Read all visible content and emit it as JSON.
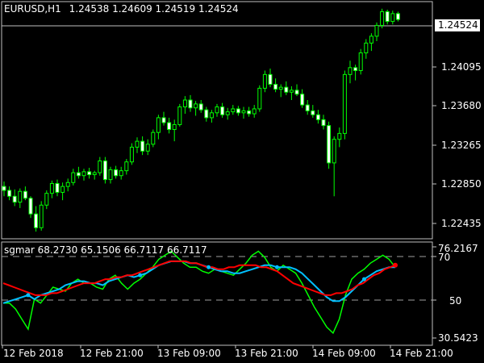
{
  "header": {
    "symbol": "EURUSD,H1",
    "ohlc": "1.24538 1.24609 1.24519 1.24524"
  },
  "indicator": {
    "label": "sgmar 68.2730 65.1506 66.7117 66.7117",
    "scale_max": "76.2167",
    "scale_min": "30.5423",
    "level_high": "70",
    "level_low": "50"
  },
  "current_price": "1.24524",
  "price_axis": [
    "1.24095",
    "1.23680",
    "1.23265",
    "1.22850",
    "1.22435"
  ],
  "time_axis": [
    "12 Feb 2018",
    "12 Feb 21:00",
    "13 Feb 09:00",
    "13 Feb 21:00",
    "14 Feb 09:00",
    "14 Feb 21:00"
  ],
  "colors": {
    "background": "#000000",
    "bull_candle": "#00ff00",
    "bear_candle": "#ffffff",
    "osc_green": "#00ff00",
    "osc_cyan": "#00c0ff",
    "osc_red": "#ff0000"
  },
  "chart_data": {
    "type": "candlestick",
    "price_range": [
      1.2232,
      1.2462
    ],
    "candles": [
      [
        1.2282,
        1.2287,
        1.2272,
        1.2278
      ],
      [
        1.2278,
        1.2282,
        1.2268,
        1.2272
      ],
      [
        1.2272,
        1.2279,
        1.2262,
        1.2266
      ],
      [
        1.2266,
        1.228,
        1.226,
        1.2277
      ],
      [
        1.2277,
        1.2282,
        1.2268,
        1.227
      ],
      [
        1.227,
        1.2272,
        1.225,
        1.2254
      ],
      [
        1.2254,
        1.2262,
        1.2236,
        1.224
      ],
      [
        1.224,
        1.2267,
        1.2237,
        1.2263
      ],
      [
        1.2263,
        1.2278,
        1.2259,
        1.2275
      ],
      [
        1.2275,
        1.2288,
        1.227,
        1.2285
      ],
      [
        1.2285,
        1.2289,
        1.2272,
        1.2276
      ],
      [
        1.2276,
        1.2286,
        1.2268,
        1.2282
      ],
      [
        1.2282,
        1.229,
        1.2277,
        1.2286
      ],
      [
        1.2286,
        1.23,
        1.2283,
        1.2296
      ],
      [
        1.2296,
        1.2302,
        1.229,
        1.2293
      ],
      [
        1.2293,
        1.23,
        1.2288,
        1.2297
      ],
      [
        1.2297,
        1.2301,
        1.229,
        1.2294
      ],
      [
        1.2294,
        1.2298,
        1.2289,
        1.2296
      ],
      [
        1.2296,
        1.2312,
        1.2293,
        1.2308
      ],
      [
        1.2308,
        1.2312,
        1.2285,
        1.2289
      ],
      [
        1.2289,
        1.2302,
        1.2285,
        1.2299
      ],
      [
        1.2299,
        1.2303,
        1.229,
        1.2293
      ],
      [
        1.2293,
        1.2302,
        1.2289,
        1.2298
      ],
      [
        1.2298,
        1.231,
        1.2294,
        1.2307
      ],
      [
        1.2307,
        1.2326,
        1.2304,
        1.2322
      ],
      [
        1.2322,
        1.2332,
        1.2316,
        1.2328
      ],
      [
        1.2328,
        1.2333,
        1.2314,
        1.2318
      ],
      [
        1.2318,
        1.233,
        1.2314,
        1.2325
      ],
      [
        1.2325,
        1.234,
        1.2322,
        1.2337
      ],
      [
        1.2337,
        1.2355,
        1.233,
        1.2352
      ],
      [
        1.2352,
        1.2358,
        1.2344,
        1.2347
      ],
      [
        1.2347,
        1.2352,
        1.2336,
        1.234
      ],
      [
        1.234,
        1.235,
        1.2328,
        1.2345
      ],
      [
        1.2345,
        1.2366,
        1.2343,
        1.2363
      ],
      [
        1.2363,
        1.2374,
        1.2356,
        1.237
      ],
      [
        1.237,
        1.2375,
        1.2358,
        1.2362
      ],
      [
        1.2362,
        1.2369,
        1.2354,
        1.2366
      ],
      [
        1.2366,
        1.237,
        1.2357,
        1.236
      ],
      [
        1.236,
        1.2363,
        1.2348,
        1.2352
      ],
      [
        1.2352,
        1.236,
        1.2347,
        1.2357
      ],
      [
        1.2357,
        1.2366,
        1.2353,
        1.2363
      ],
      [
        1.2363,
        1.2367,
        1.2352,
        1.2355
      ],
      [
        1.2355,
        1.2362,
        1.235,
        1.2358
      ],
      [
        1.2358,
        1.2365,
        1.2355,
        1.2361
      ],
      [
        1.2361,
        1.2364,
        1.2354,
        1.2357
      ],
      [
        1.2357,
        1.2363,
        1.2351,
        1.2359
      ],
      [
        1.2359,
        1.2363,
        1.2353,
        1.2356
      ],
      [
        1.2356,
        1.2365,
        1.2352,
        1.2361
      ],
      [
        1.2361,
        1.2385,
        1.2358,
        1.2382
      ],
      [
        1.2382,
        1.24,
        1.2378,
        1.2396
      ],
      [
        1.2396,
        1.2402,
        1.2383,
        1.2386
      ],
      [
        1.2386,
        1.2392,
        1.2378,
        1.2381
      ],
      [
        1.2381,
        1.2386,
        1.2373,
        1.2383
      ],
      [
        1.2383,
        1.2389,
        1.2375,
        1.2378
      ],
      [
        1.2378,
        1.2384,
        1.237,
        1.238
      ],
      [
        1.238,
        1.2386,
        1.2374,
        1.2376
      ],
      [
        1.2376,
        1.2381,
        1.2362,
        1.2365
      ],
      [
        1.2365,
        1.237,
        1.2355,
        1.2359
      ],
      [
        1.2359,
        1.2365,
        1.2352,
        1.2355
      ],
      [
        1.2355,
        1.236,
        1.2346,
        1.235
      ],
      [
        1.235,
        1.2355,
        1.234,
        1.2344
      ],
      [
        1.2344,
        1.2348,
        1.23,
        1.2306
      ],
      [
        1.2306,
        1.2333,
        1.2272,
        1.233
      ],
      [
        1.233,
        1.2342,
        1.2322,
        1.2336
      ],
      [
        1.2336,
        1.24,
        1.233,
        1.2396
      ],
      [
        1.2396,
        1.241,
        1.2387,
        1.2403
      ],
      [
        1.2403,
        1.2406,
        1.239,
        1.24
      ],
      [
        1.24,
        1.2422,
        1.2396,
        1.2418
      ],
      [
        1.2418,
        1.2432,
        1.2412,
        1.2428
      ],
      [
        1.2428,
        1.2438,
        1.242,
        1.2435
      ],
      [
        1.2435,
        1.2449,
        1.243,
        1.2446
      ],
      [
        1.2446,
        1.2463,
        1.2443,
        1.246
      ],
      [
        1.246,
        1.2462,
        1.2447,
        1.245
      ],
      [
        1.245,
        1.2461,
        1.2447,
        1.2458
      ],
      [
        1.2458,
        1.246,
        1.245,
        1.2452
      ]
    ],
    "oscillator_range": [
      30.5423,
      76.2167
    ],
    "levels": [
      70,
      50
    ],
    "series": [
      {
        "values": [
          48,
          48,
          45,
          40,
          35,
          50,
          48,
          52,
          56,
          55,
          54,
          58,
          60,
          58,
          58,
          56,
          55,
          60,
          62,
          58,
          55,
          58,
          60,
          63,
          66,
          70,
          72,
          74,
          71,
          68,
          66,
          66,
          64,
          63,
          65,
          64,
          63,
          62,
          65,
          68,
          72,
          74,
          71,
          66,
          64,
          67,
          65,
          63,
          58,
          52,
          46,
          41,
          36,
          33,
          40,
          52,
          60,
          63,
          65,
          68,
          70,
          72,
          70,
          66
        ]
      },
      {
        "values": [
          48,
          49,
          50,
          51,
          52,
          50,
          52,
          53,
          54,
          55,
          57,
          58,
          59,
          59,
          58,
          58,
          57,
          59,
          60,
          61,
          62,
          61,
          62,
          63,
          65,
          67,
          68,
          69,
          69,
          69,
          68,
          68,
          67,
          66,
          65,
          64,
          64,
          63,
          63,
          64,
          65,
          66,
          67,
          67,
          66,
          66,
          66,
          65,
          63,
          60,
          57,
          54,
          51,
          49,
          49,
          51,
          54,
          57,
          60,
          62,
          64,
          65,
          66,
          66
        ]
      },
      {
        "values": [
          58,
          57,
          56,
          55,
          54,
          53,
          52,
          52,
          52,
          53,
          53,
          54,
          55,
          56,
          57,
          58,
          58,
          58,
          59,
          60,
          60,
          61,
          61,
          62,
          62,
          63,
          64,
          65,
          66,
          67,
          68,
          69,
          69,
          69,
          69,
          68,
          68,
          67,
          66,
          66,
          65,
          65,
          66,
          66,
          67,
          67,
          67,
          67,
          66,
          66,
          65,
          64,
          62,
          60,
          58,
          57,
          56,
          55,
          54,
          53,
          52,
          52,
          53,
          53,
          54,
          55,
          57,
          58,
          60,
          62,
          63,
          65,
          66,
          67
        ]
      }
    ]
  }
}
